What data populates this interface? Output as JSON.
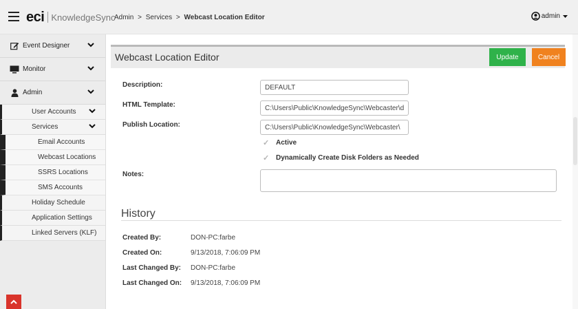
{
  "app": {
    "logo_main": "eci",
    "logo_sub": "KnowledgeSync"
  },
  "breadcrumb": {
    "items": [
      "Admin",
      "Services"
    ],
    "separator": ">",
    "current": "Webcast Location Editor"
  },
  "user": {
    "name": "admin"
  },
  "sidebar": {
    "top_items": [
      {
        "label": "Event Designer",
        "icon": "edit-icon"
      },
      {
        "label": "Monitor",
        "icon": "monitor-icon"
      },
      {
        "label": "Admin",
        "icon": "user-icon"
      }
    ],
    "admin_items": [
      {
        "label": "User Accounts",
        "expandable": true
      },
      {
        "label": "Services",
        "expandable": true
      }
    ],
    "services_items": [
      {
        "label": "Email Accounts"
      },
      {
        "label": "Webcast Locations"
      },
      {
        "label": "SSRS Locations"
      },
      {
        "label": "SMS Accounts"
      }
    ],
    "admin_items_after": [
      {
        "label": "Holiday Schedule"
      },
      {
        "label": "Application Settings"
      },
      {
        "label": "Linked Servers (KLF)"
      }
    ]
  },
  "panel": {
    "title": "Webcast Location Editor",
    "update_label": "Update",
    "cancel_label": "Cancel"
  },
  "form": {
    "description_label": "Description:",
    "description_value": "DEFAULT",
    "html_template_label": "HTML Template:",
    "html_template_value": "C:\\Users\\Public\\KnowledgeSync\\Webcaster\\d:",
    "publish_location_label": "Publish Location:",
    "publish_location_value": "C:\\Users\\Public\\KnowledgeSync\\Webcaster\\",
    "active_label": "Active",
    "create_folders_label": "Dynamically Create Disk Folders as Needed",
    "notes_label": "Notes:",
    "notes_value": ""
  },
  "history": {
    "title": "History",
    "rows": [
      {
        "label": "Created By:",
        "value": "DON-PC:farbe"
      },
      {
        "label": "Created On:",
        "value": "9/13/2018, 7:06:09 PM"
      },
      {
        "label": "Last Changed By:",
        "value": "DON-PC:farbe"
      },
      {
        "label": "Last Changed On:",
        "value": "9/13/2018, 7:06:09 PM"
      }
    ]
  },
  "colors": {
    "update_button": "#2fb24a",
    "cancel_button": "#f0821f",
    "scroll_top_button": "#d9342b"
  }
}
